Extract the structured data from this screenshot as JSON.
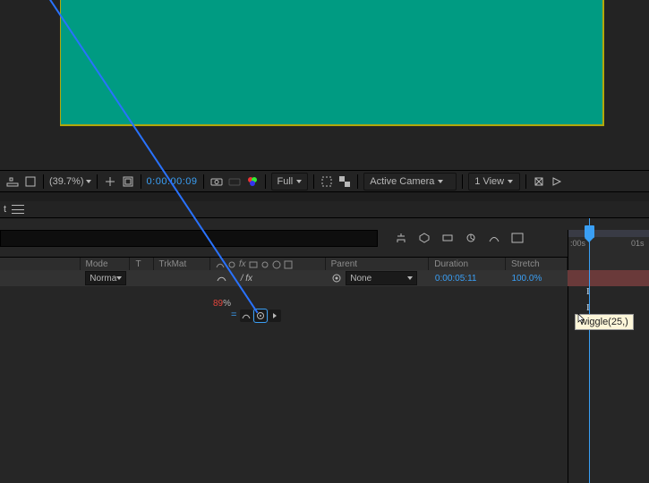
{
  "viewer": {
    "zoom": "(39.7%)",
    "timecode": "0:00:00:09",
    "resolution": "Full",
    "camera": "Active Camera",
    "view": "1 View"
  },
  "panel_tab": {
    "label": "t"
  },
  "headers": {
    "mode": "Mode",
    "t": "T",
    "trkmat": "TrkMat",
    "parent": "Parent",
    "duration": "Duration",
    "stretch": "Stretch"
  },
  "layer": {
    "blend": "Norma",
    "parent": "None",
    "duration": "0:00:05:11",
    "stretch": "100.0%"
  },
  "expression": {
    "value_pct": "89",
    "pct_sign": "%",
    "equals": "="
  },
  "ruler": {
    "labels": [
      ":00s",
      "01s"
    ]
  },
  "tooltip": "wiggle(25,)"
}
